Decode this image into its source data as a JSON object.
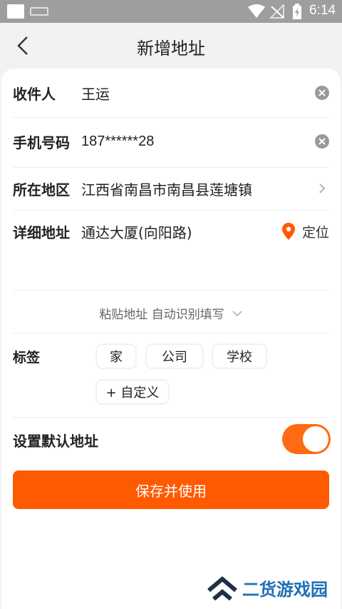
{
  "status_bar": {
    "time": "6:14"
  },
  "header": {
    "title": "新增地址"
  },
  "form": {
    "recipient": {
      "label": "收件人",
      "value": "王运"
    },
    "phone": {
      "label": "手机号码",
      "value": "187******28"
    },
    "region": {
      "label": "所在地区",
      "value": "江西省南昌市南昌县莲塘镇"
    },
    "address": {
      "label": "详细地址",
      "value": "通达大厦(向阳路)",
      "locate_label": "定位"
    },
    "paste": {
      "text": "粘贴地址 自动识别填写"
    },
    "tags": {
      "label": "标签",
      "items": [
        "家",
        "公司",
        "学校",
        "+ 自定义"
      ]
    },
    "default": {
      "label": "设置默认地址",
      "enabled": true
    }
  },
  "actions": {
    "save_label": "保存并使用"
  },
  "watermark": {
    "text": "二货游戏园"
  },
  "colors": {
    "accent": "#ff5a00",
    "toggle": "#ff6a12",
    "watermark": "#1f6fb6"
  }
}
